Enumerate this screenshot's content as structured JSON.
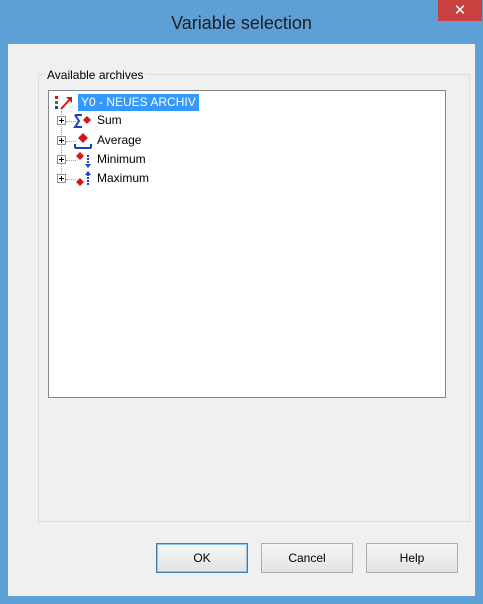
{
  "dialog": {
    "title": "Variable selection",
    "close_label": "✕"
  },
  "group": {
    "label": "Available archives"
  },
  "tree": {
    "root": {
      "label": "Y0 - NEUES ARCHIV",
      "icon": "archive-icon",
      "selected": true
    },
    "items": [
      {
        "label": "Sum",
        "icon": "sum-icon"
      },
      {
        "label": "Average",
        "icon": "average-icon"
      },
      {
        "label": "Minimum",
        "icon": "minimum-icon"
      },
      {
        "label": "Maximum",
        "icon": "maximum-icon"
      }
    ]
  },
  "buttons": {
    "ok": "OK",
    "cancel": "Cancel",
    "help": "Help"
  },
  "colors": {
    "titlebar": "#5d9fd6",
    "close": "#c94040",
    "selection": "#3399ff",
    "icon_red": "#d01818",
    "icon_blue": "#1a3ecf"
  }
}
